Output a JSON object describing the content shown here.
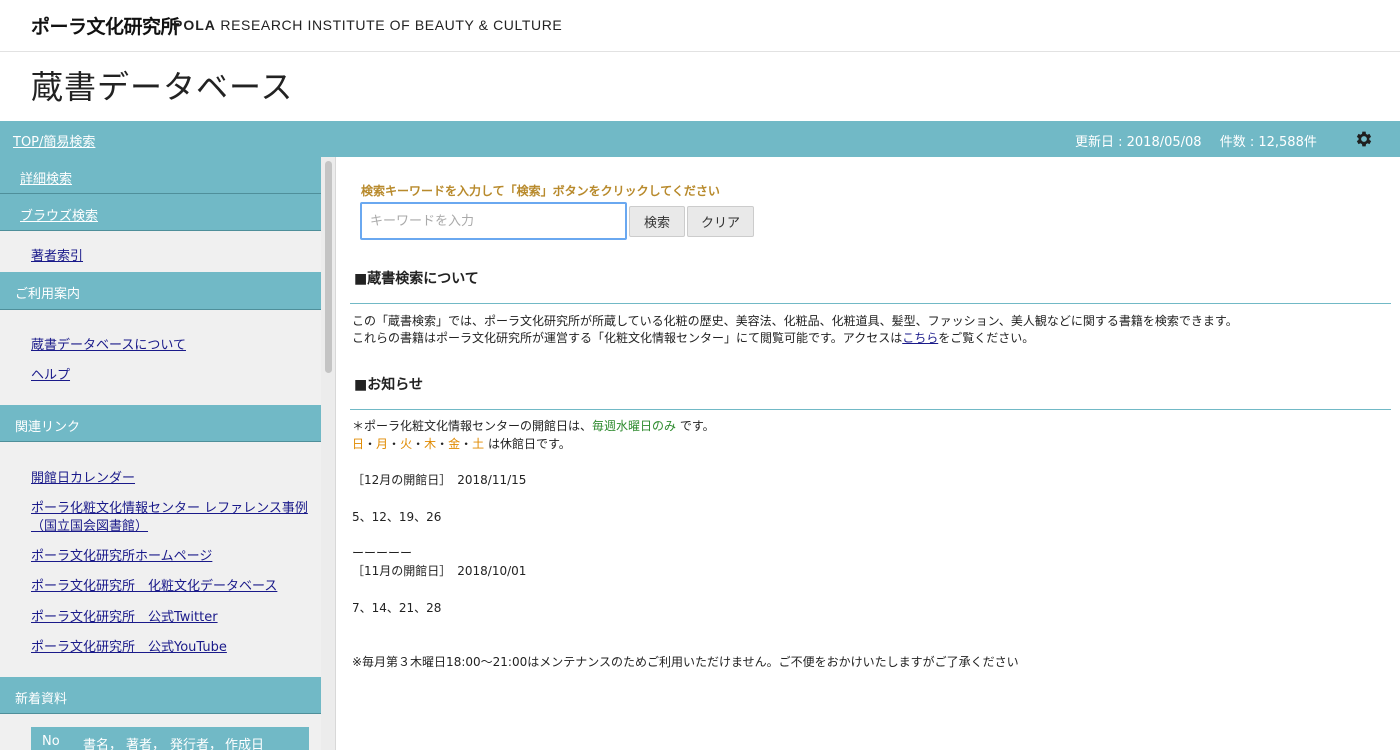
{
  "brand": {
    "jp": "ポーラ文化研究所",
    "en_bold": "POLA",
    "en_rest": " RESEARCH INSTITUTE OF BEAUTY & CULTURE"
  },
  "page_title": "蔵書データベース",
  "topbar": {
    "home_link": "TOP/簡易検索",
    "updated": "更新日 : 2018/05/08",
    "count": "件数 : 12,588件",
    "settings_icon": "gear-icon"
  },
  "sidebar": {
    "advanced_search": "詳細検索",
    "browse_search": "ブラウズ検索",
    "author_index": "著者索引",
    "guide_heading": "ご利用案内",
    "about_db": "蔵書データベースについて",
    "help": "ヘルプ",
    "links_heading": "関連リンク",
    "links": [
      "開館日カレンダー",
      "ポーラ化粧文化情報センター レファレンス事例",
      "（国立国会図書館）",
      "ポーラ文化研究所ホームページ",
      "ポーラ文化研究所　化粧文化データベース",
      "ポーラ文化研究所　公式Twitter",
      "ポーラ文化研究所　公式YouTube"
    ],
    "new_heading": "新着資料",
    "new_table_headers": [
      "No",
      "書名，",
      "著者，",
      "発行者，",
      "作成日"
    ]
  },
  "search": {
    "hint": "検索キーワードを入力して「検索」ボタンをクリックしてください",
    "placeholder": "キーワードを入力",
    "value": "",
    "search_button": "検索",
    "clear_button": "クリア"
  },
  "about": {
    "heading": "■蔵書検索について",
    "line1": "この「蔵書検索」では、ポーラ文化研究所が所蔵している化粧の歴史、美容法、化粧品、化粧道具、髪型、ファッション、美人観などに関する書籍を検索できます。",
    "line2_before": "これらの書籍はポーラ文化研究所が運営する「化粧文化情報センター」にて閲覧可能です。アクセスは",
    "line2_link": "こちら",
    "line2_after": "をご覧ください。"
  },
  "news": {
    "heading": "■お知らせ",
    "line1_before": "＊ポーラ化粧文化情報センターの開館日は、",
    "line1_highlight": "毎週水曜日のみ",
    "line1_after": " です。",
    "closed_days": [
      "日",
      "月",
      "火",
      "木",
      "金",
      "土"
    ],
    "closed_sep": "・",
    "closed_suffix": " は休館日です。",
    "dec_label": "［12月の開館日］　2018/11/15",
    "dec_days": "5、12、19、26",
    "divider": "ーーーーー",
    "nov_label": "［11月の開館日］　2018/10/01",
    "nov_days": "7、14、21、28",
    "maintenance": "※毎月第３木曜日18:00〜21:00はメンテナンスのためご利用いただけません。ご不便をおかけいたしますがご了承ください"
  }
}
